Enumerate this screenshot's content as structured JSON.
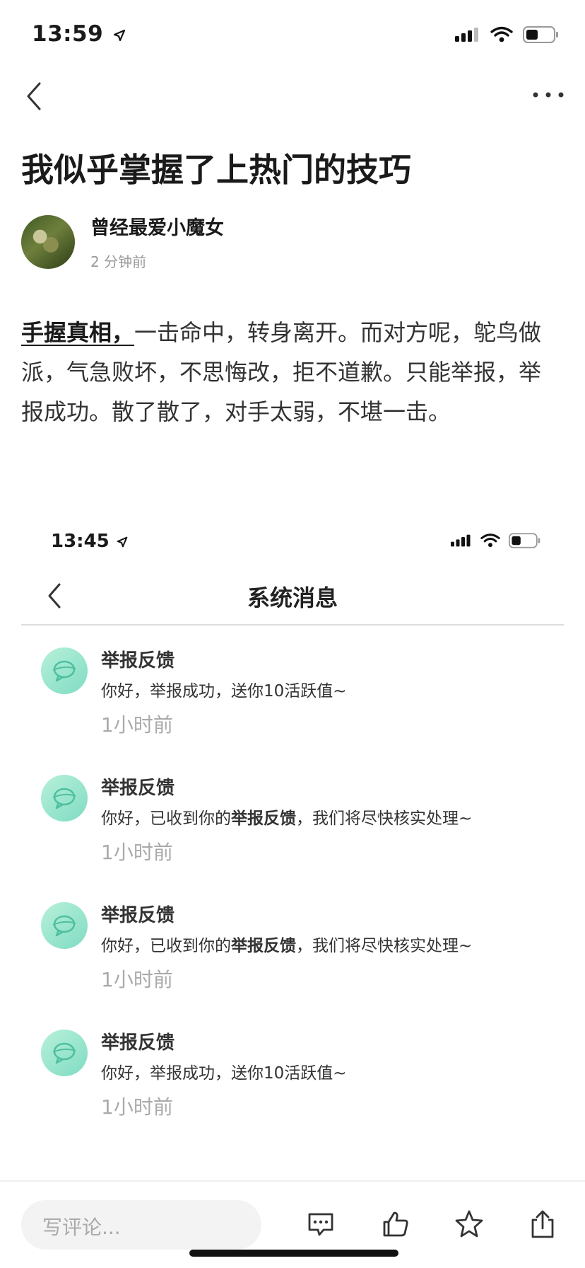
{
  "status_bar": {
    "time": "13:59"
  },
  "article": {
    "title": "我似乎掌握了上热门的技巧",
    "author": "曾经最爱小魔女",
    "time_ago": "2 分钟前",
    "body_highlight": "手握真相，",
    "body_rest": "一击命中，转身离开。而对方呢，鸵鸟做派，气急败坏，不思悔改，拒不道歉。只能举报，举报成功。散了散了，对手太弱，不堪一击。"
  },
  "embedded_screenshot": {
    "time": "13:45",
    "title": "系统消息",
    "messages": [
      {
        "title": "举报反馈",
        "text_a": "你好，举报成功，送你10活跃值~",
        "text_bold": "",
        "text_b": "",
        "time": "1小时前"
      },
      {
        "title": "举报反馈",
        "text_a": "你好，已收到你的",
        "text_bold": "举报反馈",
        "text_b": "，我们将尽快核实处理~",
        "time": "1小时前"
      },
      {
        "title": "举报反馈",
        "text_a": "你好，已收到你的",
        "text_bold": "举报反馈",
        "text_b": "，我们将尽快核实处理~",
        "time": "1小时前"
      },
      {
        "title": "举报反馈",
        "text_a": "你好，举报成功，送你10活跃值~",
        "text_bold": "",
        "text_b": "",
        "time": "1小时前"
      }
    ]
  },
  "bottom_bar": {
    "comment_placeholder": "写评论..."
  },
  "colors": {
    "accent_teal": "#7fdcc2",
    "text": "#1a1a1a",
    "muted": "#aaaaaa"
  }
}
